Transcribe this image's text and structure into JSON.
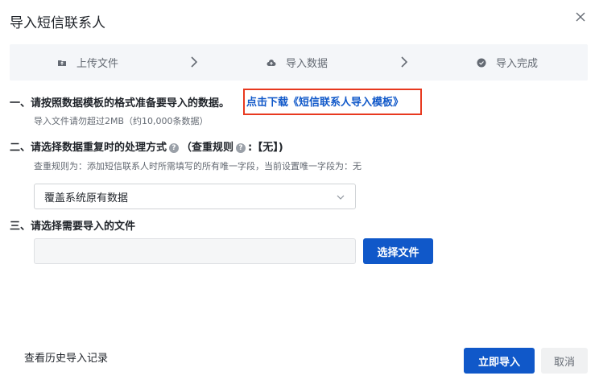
{
  "dialog": {
    "title": "导入短信联系人",
    "close_icon": "close-icon"
  },
  "steps": [
    {
      "label": "上传文件",
      "icon": "folder-icon"
    },
    {
      "label": "导入数据",
      "icon": "cloud-upload-icon"
    },
    {
      "label": "导入完成",
      "icon": "check-circle-icon"
    }
  ],
  "section1": {
    "title": "一、请按照数据模板的格式准备要导入的数据。",
    "download_link": "点击下载《短信联系人导入模板》",
    "hint": "导入文件请勿超过2MB（约10,000条数据）"
  },
  "section2": {
    "title": "二、请选择数据重复时的处理方式",
    "rule_label": "（查重规则",
    "rule_value": ":【无】)",
    "hint": "查重规则为：添加短信联系人时所需填写的所有唯一字段，当前设置唯一字段为：无",
    "select_value": "覆盖系统原有数据"
  },
  "section3": {
    "title": "三、请选择需要导入的文件",
    "choose_button": "选择文件"
  },
  "footer": {
    "history_link": "查看历史导入记录",
    "import_button": "立即导入",
    "cancel_button": "取消"
  },
  "colors": {
    "primary": "#1058c9",
    "highlight_border": "#e8391f"
  }
}
